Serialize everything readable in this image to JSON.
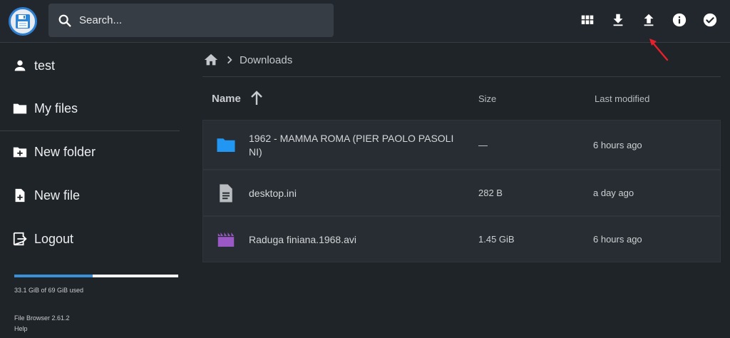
{
  "header": {
    "search_placeholder": "Search...",
    "icons": [
      "grid-view-icon",
      "download-icon",
      "upload-icon",
      "info-icon",
      "select-check-icon"
    ]
  },
  "sidebar": {
    "items": [
      {
        "label": "test",
        "icon": "person-icon"
      },
      {
        "label": "My files",
        "icon": "folder-icon"
      },
      {
        "label": "New folder",
        "icon": "create-folder-icon"
      },
      {
        "label": "New file",
        "icon": "note-add-icon"
      },
      {
        "label": "Logout",
        "icon": "logout-icon"
      }
    ],
    "usage_fraction": 0.48,
    "usage_text": "33.1 GiB of 69 GiB used",
    "version": "File Browser 2.61.2",
    "help": "Help"
  },
  "breadcrumb": {
    "items": [
      "Downloads"
    ]
  },
  "table": {
    "columns": {
      "name": "Name",
      "size": "Size",
      "modified": "Last modified"
    },
    "rows": [
      {
        "name": "1962 - MAMMA ROMA (PIER PAOLO PASOLINI)",
        "name_line1": "1962 - MAMMA ROMA (PIER PAOLO PASOLI",
        "name_line2": "NI)",
        "size": "—",
        "modified": "6 hours ago",
        "icon": "folder-icon"
      },
      {
        "name": "desktop.ini",
        "size": "282 B",
        "modified": "a day ago",
        "icon": "document-icon"
      },
      {
        "name": "Raduga finiana.1968.avi",
        "size": "1.45 GiB",
        "modified": "6 hours ago",
        "icon": "movie-icon"
      }
    ]
  },
  "colors": {
    "folder": "#2196f3",
    "movie": "#9b59c6",
    "accent": "#3a8fd9",
    "annotation_arrow": "#e8202a"
  }
}
